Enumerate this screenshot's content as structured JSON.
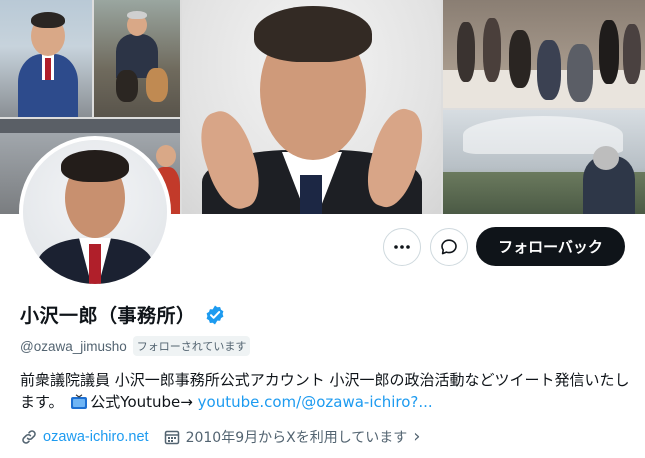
{
  "profile": {
    "display_name": "小沢一郎（事務所）",
    "handle": "@ozawa_jimusho",
    "follows_you_badge": "フォローされています",
    "verified_icon": "verified-badge-icon",
    "bio_text": "前衆議院議員 小沢一郎事務所公式アカウント 小沢一郎の政治活動などツイート発信いたします。",
    "bio_tv_icon": "tv-icon",
    "bio_youtube_label": "公式Youtube→",
    "bio_youtube_link": "youtube.com/@ozawa-ichiro?...",
    "website_link": "ozawa-ichiro.net",
    "joined_text": "2010年9月からXを利用しています",
    "joined_chevron": "›"
  },
  "actions": {
    "more_icon": "more-dots-icon",
    "message_icon": "message-icon",
    "follow_back_label": "フォローバック"
  },
  "colors": {
    "accent": "#1d9bf0",
    "text_primary": "#0f1419",
    "text_secondary": "#536471",
    "follow_button_bg": "#0f1419"
  }
}
